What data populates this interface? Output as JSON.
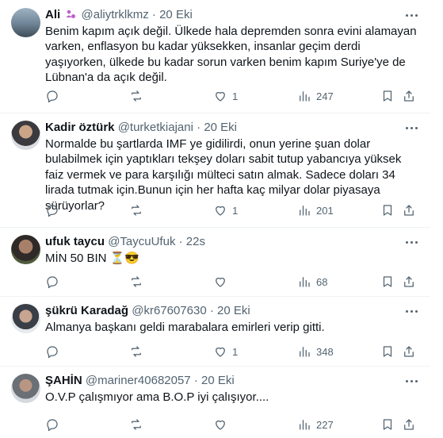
{
  "tweets": [
    {
      "name": "Ali",
      "handle": "@aliytrklkmz",
      "sep": "·",
      "time": "20 Eki",
      "text": "Benim kapım açık değil. Ülkede hala depremden sonra evini alamayan varken, enflasyon bu kadar yüksekken, insanlar geçim derdi yaşıyorken, ülkede bu kadar sorun varken benim kapım Suriye'ye de Lübnan'a da açık değil.",
      "replies": "",
      "retweets": "",
      "likes": "1",
      "views": "247"
    },
    {
      "name": "Kadir öztürk",
      "handle": "@turketkiajani",
      "sep": "·",
      "time": "20 Eki",
      "text": "Normalde bu şartlarda IMF ye gidilirdi, onun yerine şuan dolar bulabilmek için yaptıkları tekşey doları sabit tutup yabancıya yüksek faiz vermek ve para karşılığı mülteci satın almak. Sadece doları 34 lirada tutmak için.Bunun için her hafta kaç milyar dolar piyasaya sürüyorlar?",
      "replies": "",
      "retweets": "",
      "likes": "1",
      "views": "201"
    },
    {
      "name": "ufuk taycu",
      "handle": "@TaycuUfuk",
      "sep": "·",
      "time": "22s",
      "text": "MİN 50 BIN ⏳😎",
      "replies": "",
      "retweets": "",
      "likes": "",
      "views": "68"
    },
    {
      "name": "şükrü Karadağ",
      "handle": "@kr67607630",
      "sep": "·",
      "time": "20 Eki",
      "text": "Almanya başkanı geldi marabalara emirleri verip gitti.",
      "replies": "",
      "retweets": "",
      "likes": "1",
      "views": "348"
    },
    {
      "name": "ŞAHİN",
      "handle": "@mariner40682057",
      "sep": "·",
      "time": "20 Eki",
      "text": "O.V.P çalışmıyor ama B.O.P iyi çalışıyor....",
      "replies": "",
      "retweets": "",
      "likes": "",
      "views": "227"
    }
  ],
  "colors": {
    "text": "#0f1419",
    "muted": "#536471",
    "border": "#eff3f4"
  },
  "icons": [
    "reply-icon",
    "retweet-icon",
    "like-icon",
    "views-icon",
    "bookmark-icon",
    "share-icon",
    "more-icon"
  ]
}
